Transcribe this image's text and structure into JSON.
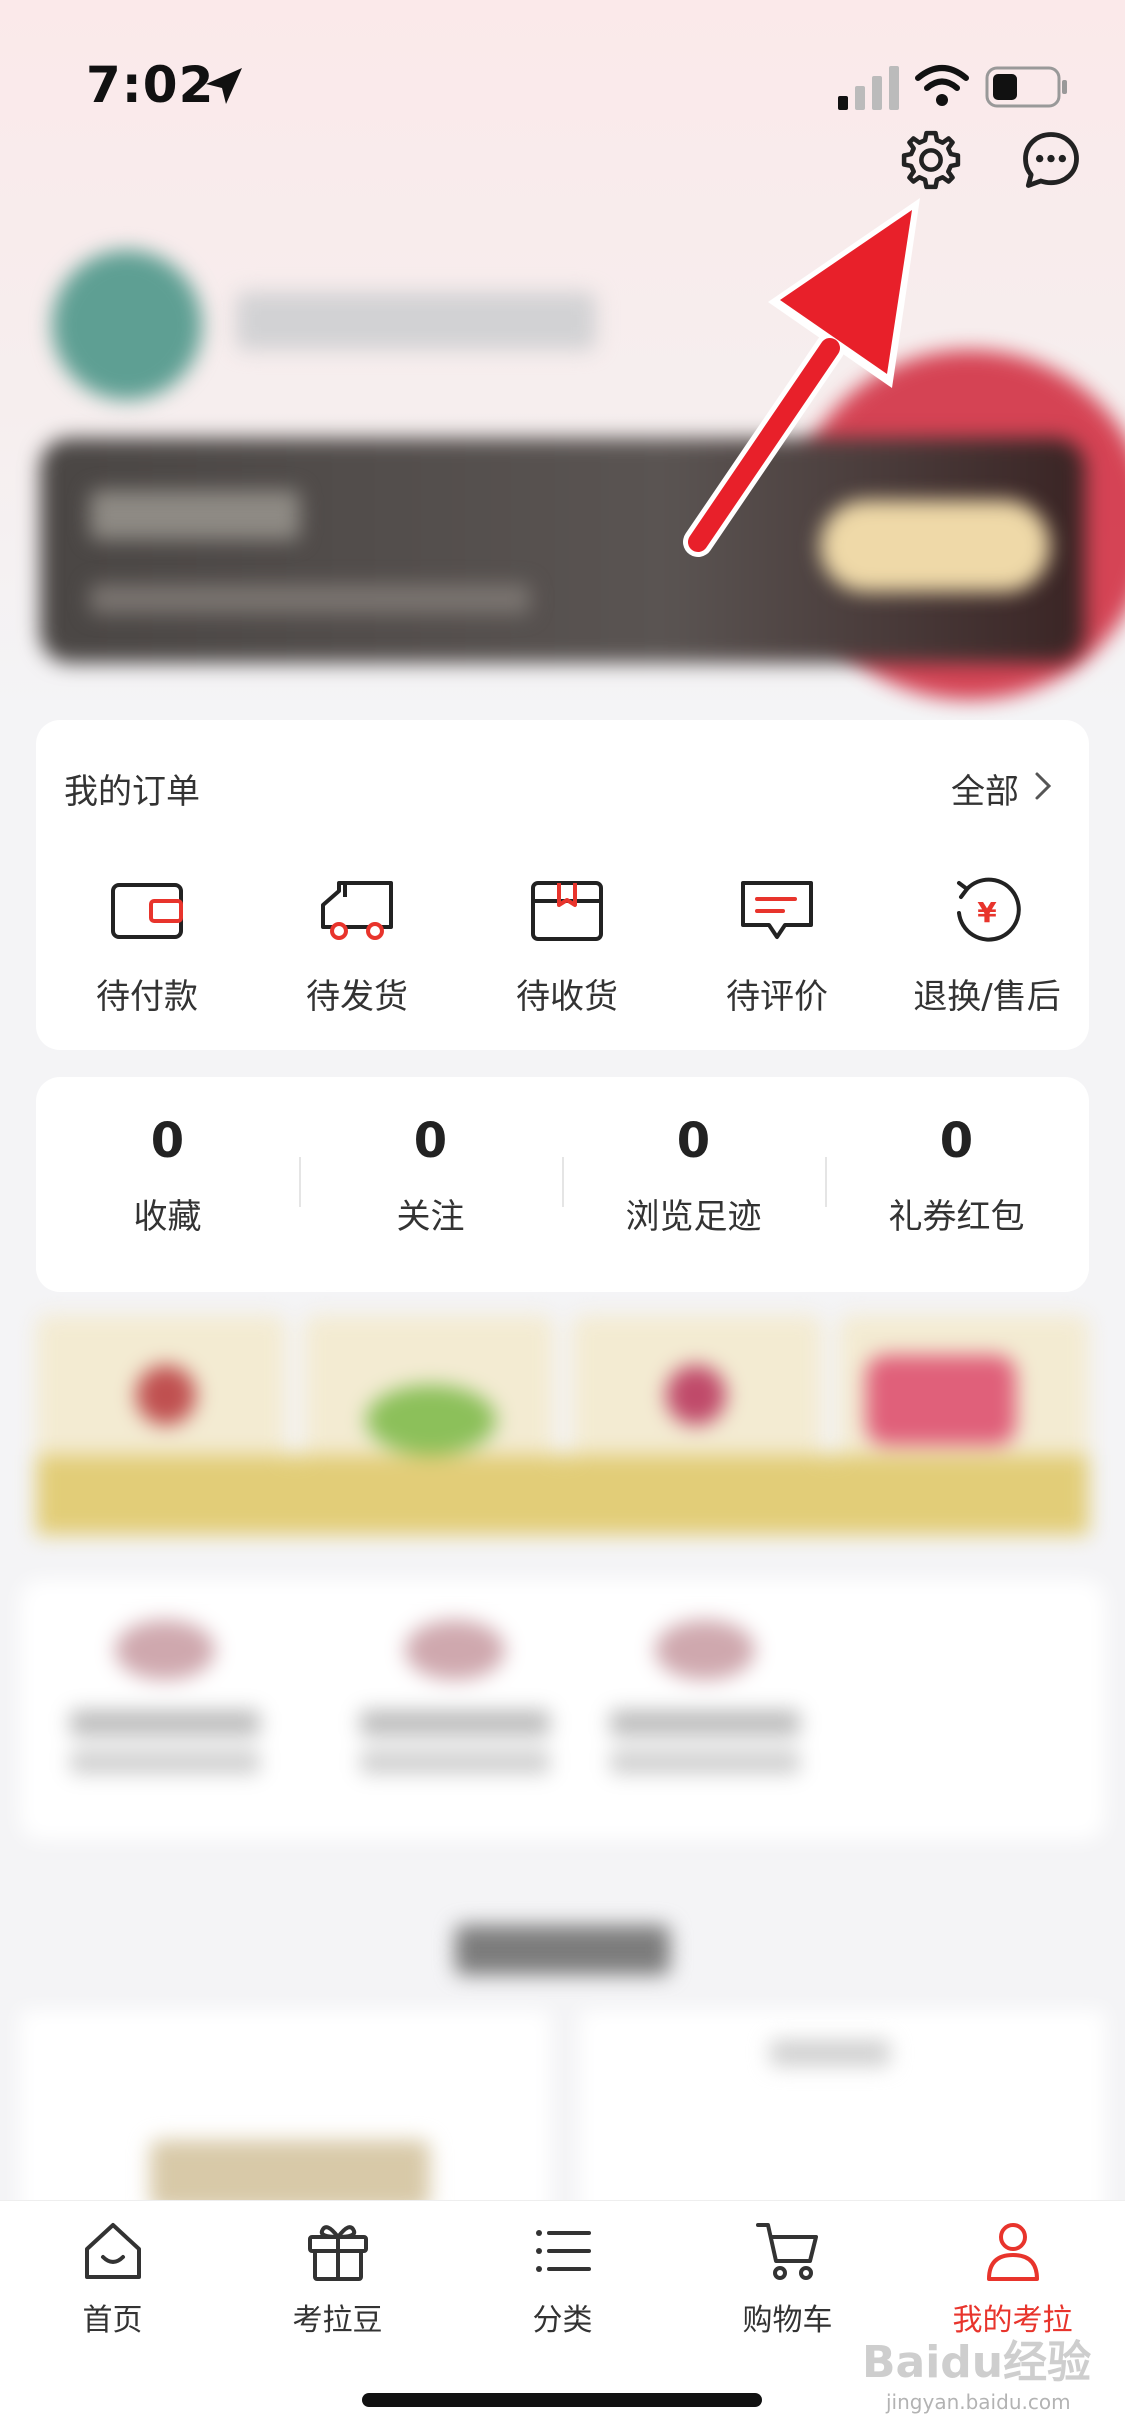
{
  "status_bar": {
    "time": "7:02"
  },
  "orders": {
    "title": "我的订单",
    "all_label": "全部",
    "items": [
      {
        "label": "待付款",
        "icon": "wallet-icon"
      },
      {
        "label": "待发货",
        "icon": "truck-icon"
      },
      {
        "label": "待收货",
        "icon": "package-icon"
      },
      {
        "label": "待评价",
        "icon": "comment-icon"
      },
      {
        "label": "退换/售后",
        "icon": "refund-icon"
      }
    ]
  },
  "stats": [
    {
      "value": "0",
      "label": "收藏"
    },
    {
      "value": "0",
      "label": "关注"
    },
    {
      "value": "0",
      "label": "浏览足迹"
    },
    {
      "value": "0",
      "label": "礼券红包"
    }
  ],
  "tab_bar": {
    "items": [
      {
        "label": "首页",
        "icon": "home-icon",
        "active": false
      },
      {
        "label": "考拉豆",
        "icon": "gift-icon",
        "active": false
      },
      {
        "label": "分类",
        "icon": "list-icon",
        "active": false
      },
      {
        "label": "购物车",
        "icon": "cart-icon",
        "active": false
      },
      {
        "label": "我的考拉",
        "icon": "user-icon",
        "active": true
      }
    ]
  },
  "watermark": {
    "text": "Baidu经验",
    "sub": "jingyan.baidu.com"
  },
  "colors": {
    "accent": "#e8342c",
    "arrow": "#e8202a"
  }
}
